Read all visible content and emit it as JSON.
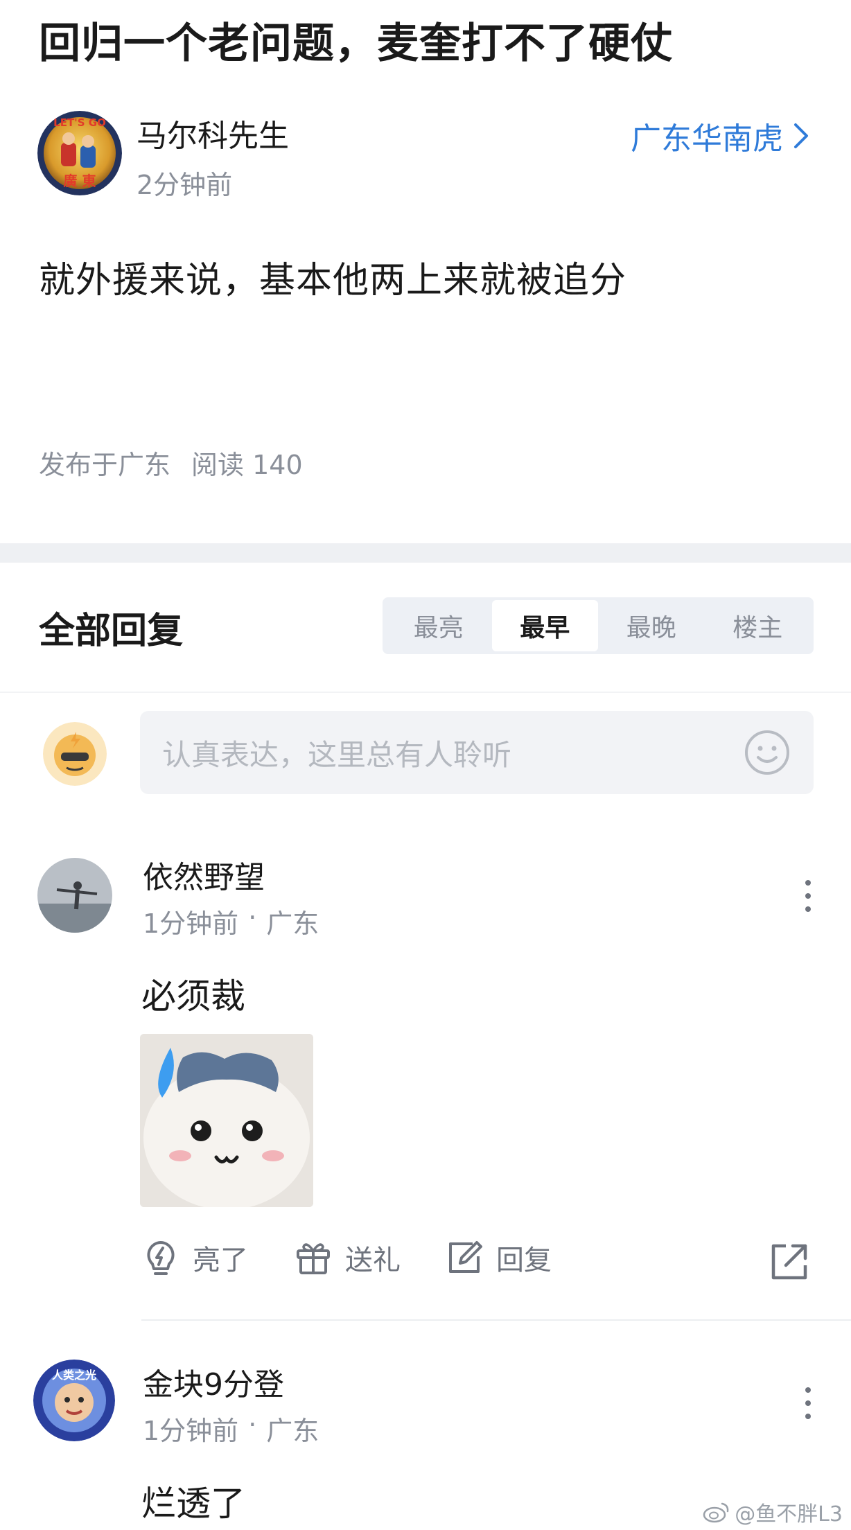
{
  "post": {
    "title": "回归一个老问题，麦奎打不了硬仗",
    "author": {
      "name": "马尔科先生",
      "time": "2分钟前",
      "avatar_text_top": "LET'S GO",
      "avatar_text_bottom": "廣 東"
    },
    "topic": "广东华南虎",
    "body": "就外援来说，基本他两上来就被追分",
    "published_in": "发布于广东",
    "reads": "阅读 140"
  },
  "replies": {
    "header": "全部回复",
    "sort_tabs": [
      {
        "label": "最亮",
        "active": false
      },
      {
        "label": "最早",
        "active": true
      },
      {
        "label": "最晚",
        "active": false
      },
      {
        "label": "楼主",
        "active": false
      }
    ],
    "input_placeholder": "认真表达，这里总有人聆听",
    "comments": [
      {
        "name": "依然野望",
        "time": "1分钟前",
        "dot": "·",
        "location": "广东",
        "text": "必须裁",
        "has_sticker": true
      },
      {
        "name": "金块9分登",
        "time": "1分钟前",
        "dot": "·",
        "location": "广东",
        "text": "烂透了",
        "avatar_text": "人类之光"
      }
    ],
    "actions": {
      "like": "亮了",
      "gift": "送礼",
      "reply": "回复"
    }
  },
  "watermark": "@鱼不胖L3",
  "colors": {
    "accent_blue": "#2f7bd9",
    "muted_text": "#8a8f99",
    "divider": "#eef0f3"
  }
}
